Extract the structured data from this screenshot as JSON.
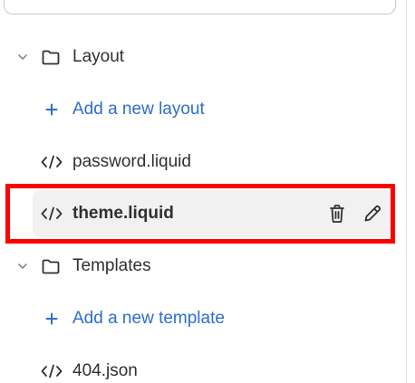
{
  "tree": {
    "layout_folder": {
      "label": "Layout",
      "icon": "folder-icon",
      "expanded": true
    },
    "add_layout": {
      "label": "Add a new layout",
      "icon": "plus-icon"
    },
    "files": [
      {
        "label": "password.liquid",
        "icon": "code-icon"
      },
      {
        "label": "theme.liquid",
        "icon": "code-icon",
        "selected": true,
        "actions": [
          "trash-icon",
          "pencil-icon"
        ]
      }
    ],
    "templates_folder": {
      "label": "Templates",
      "icon": "folder-icon",
      "expanded": true
    },
    "add_template": {
      "label": "Add a new template",
      "icon": "plus-icon"
    },
    "template_files": [
      {
        "label": "404.json",
        "icon": "code-icon"
      }
    ]
  },
  "colors": {
    "link": "#2c6ecb",
    "text": "#303030",
    "selected_bg": "#f1f1f1",
    "highlight_border": "#ff0000"
  }
}
